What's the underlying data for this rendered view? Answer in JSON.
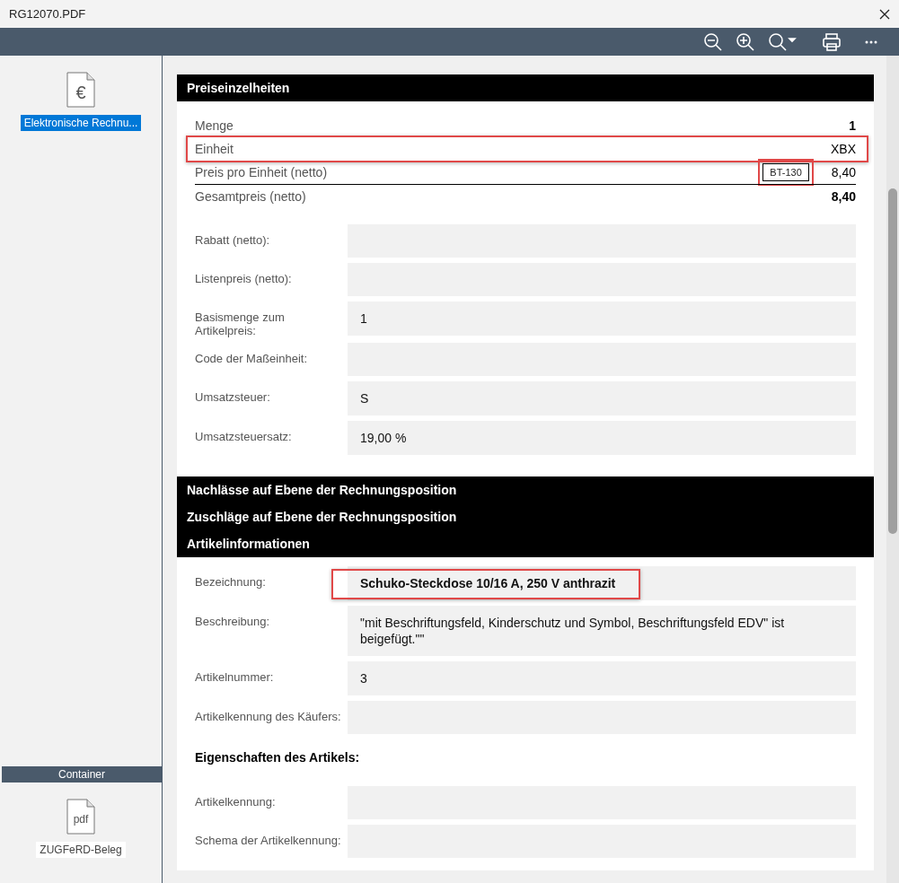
{
  "window": {
    "title": "RG12070.PDF"
  },
  "sidebar": {
    "items": [
      {
        "icon_text": "€",
        "label": "Elektronische Rechnu...",
        "selected": true
      }
    ],
    "container": {
      "title": "Container",
      "items": [
        {
          "icon_text": "pdf",
          "label": "ZUGFeRD-Beleg",
          "selected": false
        }
      ]
    }
  },
  "price_section": {
    "title": "Preiseinzelheiten",
    "rows": [
      {
        "kind": "plain",
        "label": "Menge",
        "value": "1",
        "highlighted": false
      },
      {
        "kind": "plain",
        "label": "Einheit",
        "value": "XBX",
        "highlighted": true
      },
      {
        "kind": "tagged",
        "label": "Preis pro Einheit (netto)",
        "tag": "BT-130",
        "value": "8,40",
        "highlighted": true
      },
      {
        "kind": "total",
        "label": "Gesamtpreis (netto)",
        "value": "8,40",
        "highlighted": false
      }
    ],
    "fields": [
      {
        "label": "Rabatt (netto):"
      },
      {
        "label": "Listenpreis (netto):"
      },
      {
        "label": "Basismenge zum Artikelpreis:",
        "value": "1"
      },
      {
        "label": "Code der Maßeinheit:"
      },
      {
        "label": "Umsatzsteuer:",
        "value": "S"
      },
      {
        "label": "Umsatzsteuersatz:",
        "value": "19,00 %"
      }
    ]
  },
  "collapsed_sections": [
    "Nachlässe auf Ebene der Rechnungsposition",
    "Zuschläge auf Ebene der Rechnungsposition"
  ],
  "article_section": {
    "title": "Artikelinformationen",
    "fields": [
      {
        "kind": "emphasis",
        "label": "Bezeichnung:",
        "value": "Schuko-Steckdose 10/16 A, 250 V anthrazit",
        "highlighted": true
      },
      {
        "kind": "plain",
        "label": "Beschreibung:",
        "value": "\"mit Beschriftungsfeld, Kinderschutz und Symbol, Beschriftungsfeld EDV\" ist beigefügt.\"\"",
        "highlighted": false
      },
      {
        "kind": "plain",
        "label": "Artikelnummer:",
        "value": "3",
        "highlighted": false
      },
      {
        "kind": "plain",
        "label": "Artikelkennung des Käufers:",
        "highlighted": false
      }
    ],
    "subheading": "Eigenschaften des Artikels:",
    "property_fields": [
      {
        "label": "Artikelkennung:"
      },
      {
        "label": "Schema der Artikelkennung:"
      }
    ]
  }
}
